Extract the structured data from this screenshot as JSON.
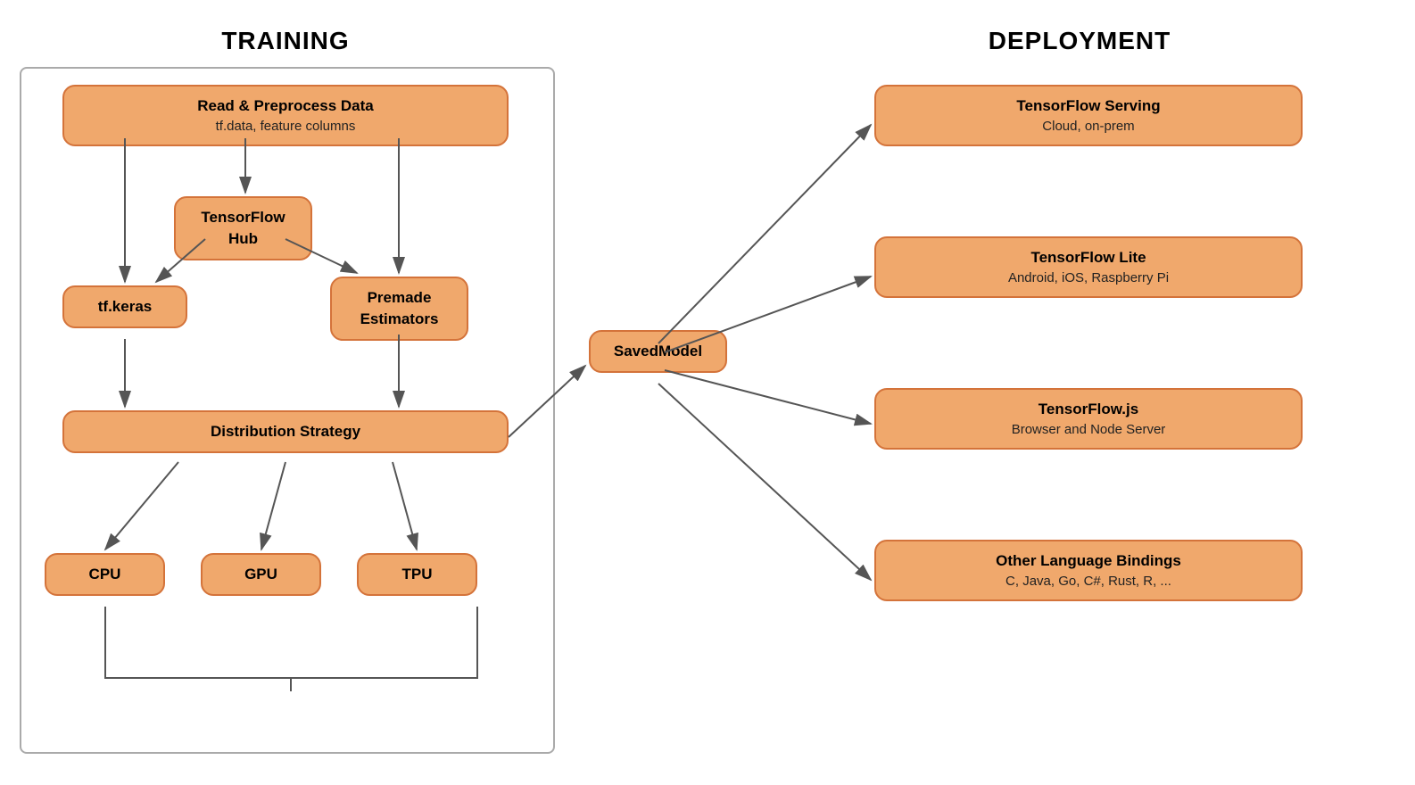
{
  "training": {
    "title": "TRAINING",
    "nodes": {
      "read": {
        "title": "Read & Preprocess Data",
        "sub": "tf.data, feature columns"
      },
      "tfhub": {
        "title": "TensorFlow\nHub"
      },
      "keras": {
        "title": "tf.keras"
      },
      "estimators": {
        "title": "Premade\nEstimators"
      },
      "dist": {
        "title": "Distribution Strategy"
      },
      "cpu": {
        "title": "CPU"
      },
      "gpu": {
        "title": "GPU"
      },
      "tpu": {
        "title": "TPU"
      }
    }
  },
  "saved_model": {
    "title": "SavedModel"
  },
  "deployment": {
    "title": "DEPLOYMENT",
    "nodes": {
      "serving": {
        "title": "TensorFlow Serving",
        "sub": "Cloud, on-prem"
      },
      "lite": {
        "title": "TensorFlow Lite",
        "sub": "Android, iOS, Raspberry Pi"
      },
      "js": {
        "title": "TensorFlow.js",
        "sub": "Browser and Node Server"
      },
      "other": {
        "title": "Other Language Bindings",
        "sub": "C, Java, Go, C#, Rust, R, ..."
      }
    }
  }
}
